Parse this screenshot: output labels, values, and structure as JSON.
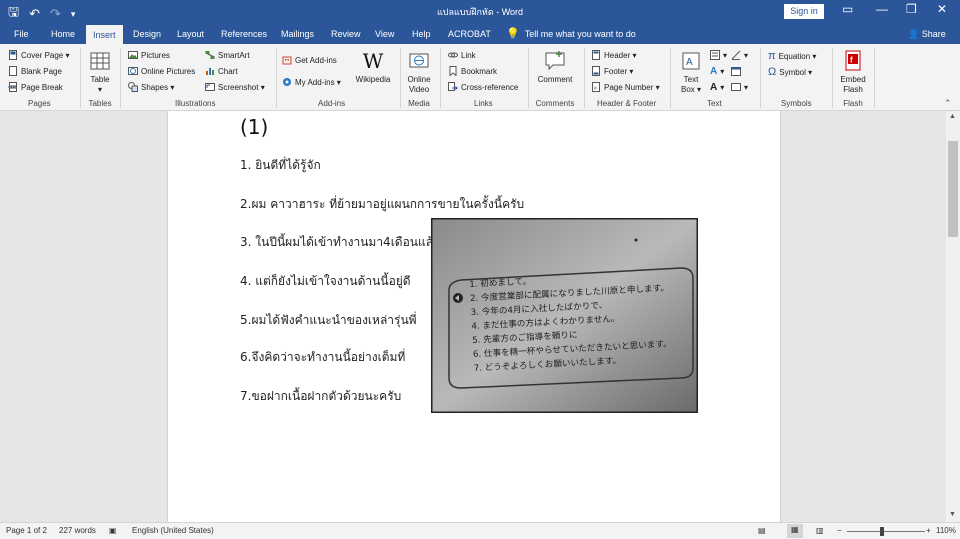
{
  "titlebar": {
    "doc_title": "แปลแบบฝึกหัด - Word",
    "signin": "Sign in",
    "qat": {
      "save": "🖫",
      "undo": "↶",
      "redo": "↷",
      "more": "▾"
    },
    "controls": {
      "ribbon_opts": "▭",
      "minimize": "—",
      "restore": "❐",
      "close": "✕"
    }
  },
  "tabs": [
    "File",
    "Home",
    "Insert",
    "Design",
    "Layout",
    "References",
    "Mailings",
    "Review",
    "View",
    "Help",
    "ACROBAT"
  ],
  "active_tab": "Insert",
  "tellme": "Tell me what you want to do",
  "share": "Share",
  "ribbon": {
    "pages": {
      "cover_page": "Cover Page ▾",
      "blank_page": "Blank Page",
      "page_break": "Page Break",
      "label": "Pages"
    },
    "tables": {
      "table": "Table",
      "table_caret": "▾",
      "label": "Tables"
    },
    "illustrations": {
      "pictures": "Pictures",
      "online_pictures": "Online Pictures",
      "shapes": "Shapes ▾",
      "smartart": "SmartArt",
      "chart": "Chart",
      "screenshot": "Screenshot ▾",
      "label": "Illustrations"
    },
    "addins": {
      "get_addins": "Get Add-ins",
      "my_addins": "My Add-ins ▾",
      "wikipedia": "Wikipedia",
      "wiki_glyph": "W",
      "label": "Add-ins"
    },
    "media": {
      "online_video_1": "Online",
      "online_video_2": "Video",
      "label": "Media"
    },
    "links": {
      "link": "Link",
      "bookmark": "Bookmark",
      "cross_reference": "Cross-reference",
      "label": "Links"
    },
    "comments": {
      "comment": "Comment",
      "label": "Comments"
    },
    "header_footer": {
      "header": "Header ▾",
      "footer": "Footer ▾",
      "page_number": "Page Number ▾",
      "label": "Header & Footer"
    },
    "text": {
      "text_box_1": "Text",
      "text_box_2": "Box ▾",
      "label": "Text"
    },
    "symbols": {
      "equation": "Equation ▾",
      "symbol": "Symbol ▾",
      "equation_glyph": "π",
      "symbol_glyph": "Ω",
      "label": "Symbols"
    },
    "flash": {
      "embed_1": "Embed",
      "embed_2": "Flash",
      "label": "Flash"
    }
  },
  "document": {
    "heading": "(1)",
    "lines": [
      "1. ยินดีที่ได้รู้จัก",
      "2.ผม คาวาฮาระ ที่ย้ายมาอยู่แผนกการขายในครั้งนี้ครับ",
      "3. ในปีนี้ผมได้เข้าทำงานมา4เดือนแล้ว",
      "4. แต่ก็ยังไม่เข้าใจงานด้านนี้อยู่ดี",
      "5.ผมได้ฟังคำแนะนำของเหล่ารุ่นพี่",
      "6.จึงคิดว่าจะทำงานนี้อย่างเต็มที่",
      "7.ขอฝากเนื้อฝากตัวด้วยนะครับ"
    ],
    "photo": {
      "lines": [
        "1. 初めまして。",
        "2. 今度営業部に配属になりました川原と申します。",
        "3. 今年の4月に入社したばかりで、",
        "4. まだ仕事の方はよくわかりません。",
        "5. 先輩方のご指導を頼りに",
        "6. 仕事を精一杯やらせていただきたいと思います。",
        "7. どうぞよろしくお願いいたします。"
      ]
    }
  },
  "status": {
    "page": "Page 1 of 2",
    "words": "227 words",
    "language": "English (United States)",
    "zoom": "110%",
    "zoom_minus": "−",
    "zoom_plus": "+"
  },
  "colors": {
    "accent": "#2b579a"
  }
}
